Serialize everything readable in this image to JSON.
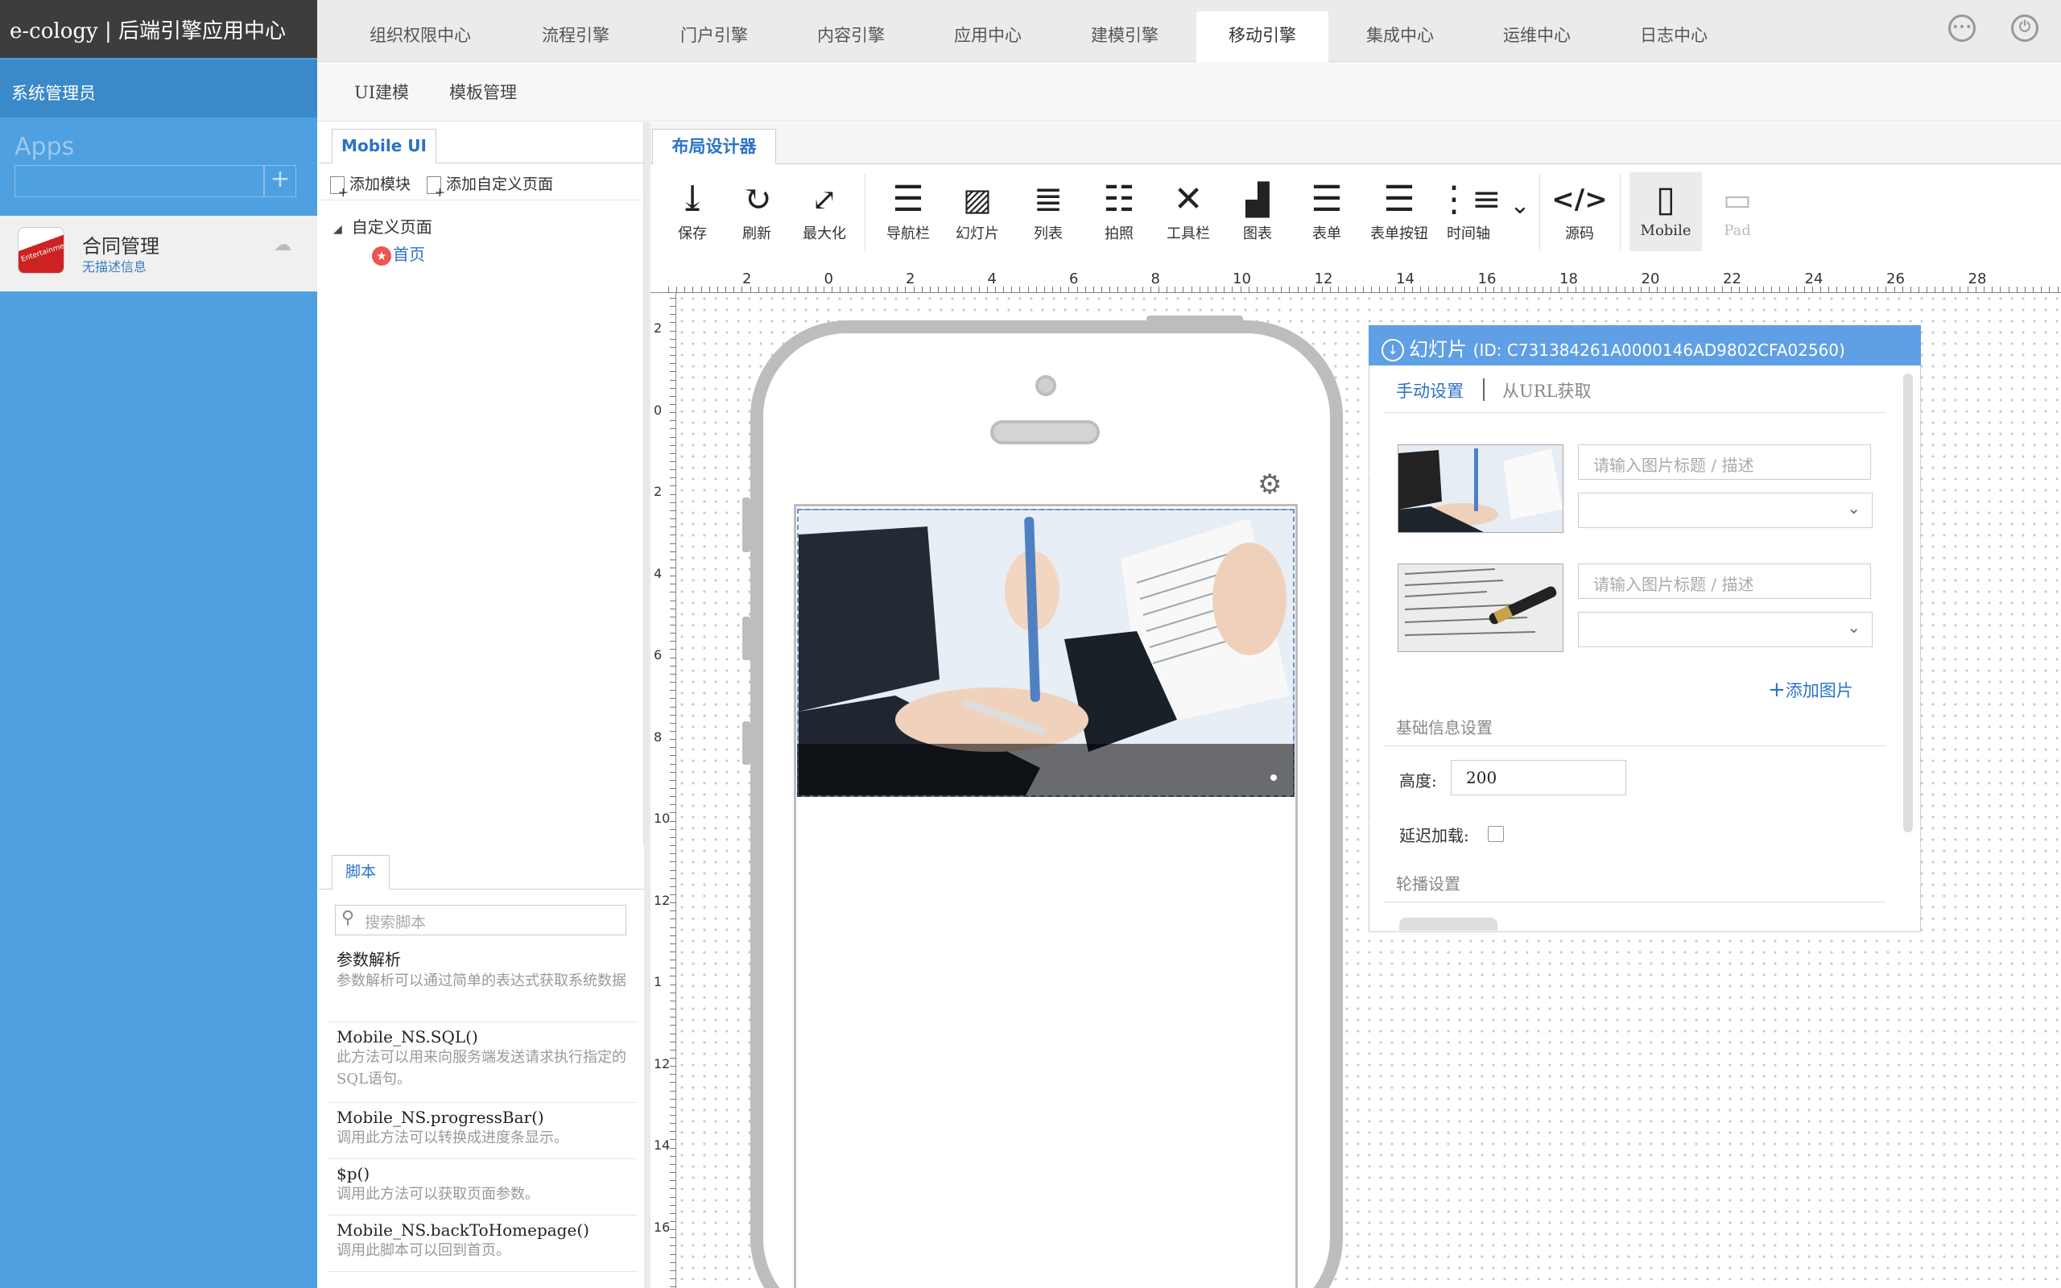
{
  "brand": {
    "title": "e-cology | 后端引擎应用中心"
  },
  "topnav": {
    "items": [
      {
        "label": "组织权限中心"
      },
      {
        "label": "流程引擎"
      },
      {
        "label": "门户引擎"
      },
      {
        "label": "内容引擎"
      },
      {
        "label": "应用中心"
      },
      {
        "label": "建模引擎"
      },
      {
        "label": "移动引擎"
      },
      {
        "label": "集成中心"
      },
      {
        "label": "运维中心"
      },
      {
        "label": "日志中心"
      }
    ],
    "active": "移动引擎"
  },
  "sidebar": {
    "role": "系统管理员",
    "apps_label": "Apps",
    "app": {
      "name": "合同管理",
      "desc": "无描述信息",
      "icon_text": "Entertainment"
    }
  },
  "subnav": {
    "items": [
      {
        "label": "UI建模"
      },
      {
        "label": "模板管理"
      }
    ]
  },
  "left_panel": {
    "tab": "Mobile UI",
    "add_module": "添加模块",
    "add_custom_page": "添加自定义页面",
    "tree": {
      "root": "自定义页面",
      "child": "首页"
    }
  },
  "scripts": {
    "tab": "脚本",
    "search_placeholder": "搜索脚本",
    "items": [
      {
        "title": "参数解析",
        "desc": "参数解析可以通过简单的表达式获取系统数据"
      },
      {
        "title": "Mobile_NS.SQL()",
        "desc": "此方法可以用来向服务端发送请求执行指定的SQL语句。"
      },
      {
        "title": "Mobile_NS.progressBar()",
        "desc": "调用此方法可以转换成进度条显示。"
      },
      {
        "title": "$p()",
        "desc": "调用此方法可以获取页面参数。"
      },
      {
        "title": "Mobile_NS.backToHomepage()",
        "desc": "调用此脚本可以回到首页。"
      }
    ]
  },
  "designer": {
    "tab": "布局设计器",
    "toolbar": [
      {
        "label": "保存"
      },
      {
        "label": "刷新"
      },
      {
        "label": "最大化"
      },
      {
        "label": "导航栏"
      },
      {
        "label": "幻灯片"
      },
      {
        "label": "列表"
      },
      {
        "label": "拍照"
      },
      {
        "label": "工具栏"
      },
      {
        "label": "图表"
      },
      {
        "label": "表单"
      },
      {
        "label": "表单按钮"
      },
      {
        "label": "时间轴"
      },
      {
        "label": "源码"
      },
      {
        "label": "Mobile"
      },
      {
        "label": "Pad"
      }
    ],
    "ruler_top": [
      "2",
      "0",
      "2",
      "4",
      "6",
      "8",
      "10",
      "12",
      "14",
      "16",
      "18",
      "20",
      "22",
      "24",
      "26",
      "28"
    ],
    "ruler_left": [
      "2",
      "0",
      "2",
      "4",
      "6",
      "8",
      "10",
      "12",
      "1",
      "12",
      "14",
      "16"
    ]
  },
  "props": {
    "title": "幻灯片",
    "id_text": "(ID:  C731384261A0000146AD9802CFA02560)",
    "tab_manual": "手动设置",
    "tab_url": "从URL获取",
    "img_placeholder": "请输入图片标题 / 描述",
    "add_image": "添加图片",
    "basic_section": "基础信息设置",
    "height_label": "高度:",
    "height_value": "200",
    "lazy_label": "延迟加载:",
    "lazy_checked": false,
    "carousel_section": "轮播设置"
  }
}
